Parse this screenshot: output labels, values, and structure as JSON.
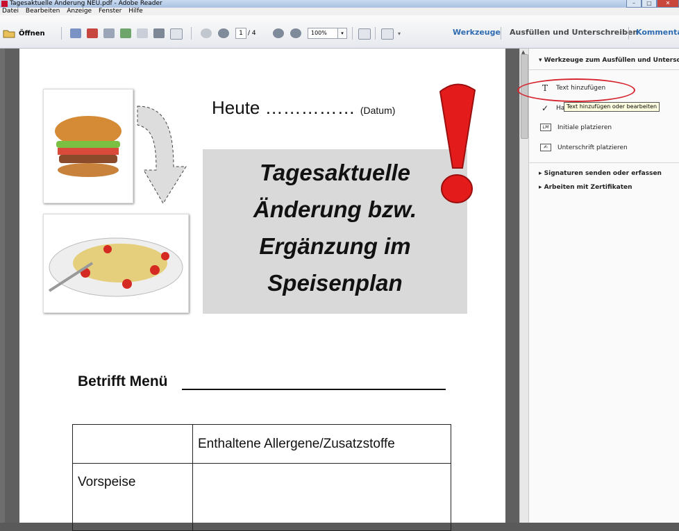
{
  "window": {
    "title": "Tagesaktuelle Änderung NEU.pdf - Adobe Reader"
  },
  "menu": [
    "Datei",
    "Bearbeiten",
    "Anzeige",
    "Fenster",
    "Hilfe"
  ],
  "toolbar": {
    "open_label": "Öffnen",
    "page_current": "1",
    "page_total": "/ 4",
    "zoom": "100%",
    "tabs": [
      "Werkzeuge",
      "Ausfüllen und Unterschreiben",
      "Kommentar"
    ]
  },
  "panel": {
    "header": "Werkzeuge zum Ausfüllen und Unterschr...",
    "items": [
      {
        "label": "Text hinzufügen",
        "icon": "T"
      },
      {
        "label": "Ha",
        "icon": "✓"
      },
      {
        "label": "Initiale platzieren",
        "icon": "LM"
      },
      {
        "label": "Unterschrift platzieren",
        "icon": "sig"
      }
    ],
    "sections": [
      "Signaturen senden oder erfassen",
      "Arbeiten mit Zertifikaten"
    ],
    "tooltip": "Text hinzufügen oder bearbeiten"
  },
  "document": {
    "heute": "Heute ……………",
    "datum": "(Datum)",
    "title_lines": [
      "Tagesaktuelle",
      "Änderung bzw.",
      "Ergänzung im",
      "Speisenplan"
    ],
    "betrifft": "Betrifft Menü",
    "table": {
      "header": [
        "",
        "Enthaltene Allergene/Zusatzstoffe"
      ],
      "rows": [
        [
          "Vorspeise",
          ""
        ]
      ]
    }
  },
  "colors": {
    "accent_red": "#d6252f",
    "tab_blue": "#2f6bb0",
    "graybox": "#d9d9d9"
  }
}
